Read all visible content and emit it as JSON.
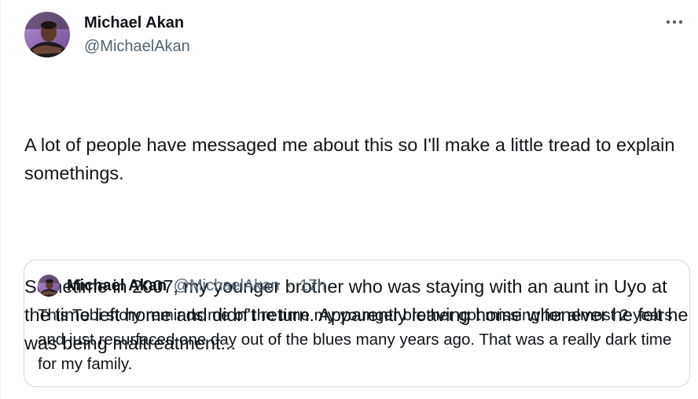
{
  "tweet": {
    "author": {
      "name": "Michael Akan",
      "handle": "@MichaelAkan"
    },
    "more_icon": "more-horizontal-icon",
    "text": {
      "paragraph_1": "A lot of people have messaged me about this so I'll make a little tread to explain somethings.",
      "paragraph_2": "Sometime in 2007, my younger brother who was staying with an aunt in Uyo at the time left home and didn't return. Apparently leaving home whenever he felt he was being maltreatment..."
    }
  },
  "quoted_tweet": {
    "author": {
      "name": "Michael Akan",
      "handle": "@MichaelAkan"
    },
    "separator": "·",
    "time": "17h",
    "text": "This Tobi story reminds me of the time my younger brother got missing for almost 2 years and just resurfaced one day out of the blues many years ago. That was a really dark time for my family."
  },
  "colors": {
    "text_primary": "#0f1419",
    "text_secondary": "#536471",
    "border": "#cfd9de"
  }
}
